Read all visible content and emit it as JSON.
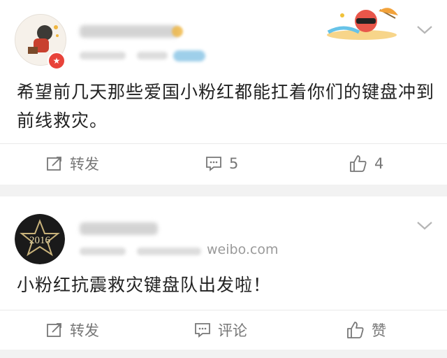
{
  "posts": [
    {
      "text": "希望前几天那些爱国小粉红都能扛着你们的键盘冲到前线救灾。",
      "actions": {
        "repost": "转发",
        "comment": "5",
        "like": "4"
      }
    },
    {
      "avatar_text": "2016",
      "source": "weibo.com",
      "text": "小粉红抗震救灾键盘队出发啦！",
      "actions": {
        "repost": "转发",
        "comment": "评论",
        "like": "赞"
      }
    }
  ],
  "colors": {
    "background": "#f2f2f2",
    "card": "#ffffff",
    "text": "#222222",
    "secondary": "#777777",
    "badge": "#e8433a"
  },
  "icons": [
    "repost-icon",
    "comment-icon",
    "like-icon",
    "chevron-down-icon",
    "verified-badge-icon"
  ]
}
